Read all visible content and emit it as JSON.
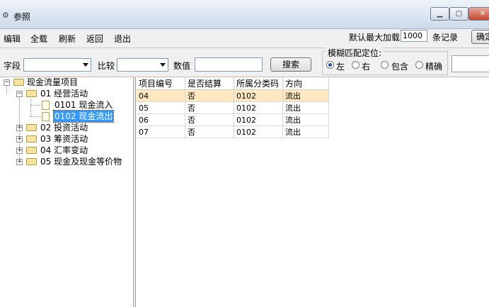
{
  "window": {
    "title": "参照",
    "icon": "app-logo-icon"
  },
  "toolbar": {
    "items": [
      "编辑",
      "全载",
      "刷新",
      "返回",
      "退出"
    ],
    "max_load_label": "默认最大加载",
    "max_load_value": "1000",
    "record_label": "条记录",
    "confirm_label": "确定"
  },
  "search": {
    "field_label": "字段",
    "compare_label": "比较",
    "value_label": "数值",
    "search_button": "搜索",
    "fuzzy_legend": "模糊匹配定位:",
    "options": [
      "左",
      "右",
      "包含",
      "精确"
    ],
    "selected_option": "左"
  },
  "tree": {
    "root": "现金流量项目",
    "nodes": [
      {
        "label": "01 经营活动",
        "children": [
          "0101 现金流入",
          "0102 现金流出"
        ]
      },
      {
        "label": "02 投资活动"
      },
      {
        "label": "03 筹资活动"
      },
      {
        "label": "04 汇率变动"
      },
      {
        "label": "05 现金及现金等价物"
      }
    ],
    "selected": "0102 现金流出"
  },
  "grid": {
    "columns": [
      "项目编号",
      "是否结算",
      "所属分类码",
      "方向"
    ],
    "rows": [
      [
        "04",
        "否",
        "0102",
        "流出"
      ],
      [
        "05",
        "否",
        "0102",
        "流出"
      ],
      [
        "06",
        "否",
        "0102",
        "流出"
      ],
      [
        "07",
        "否",
        "0102",
        "流出"
      ]
    ],
    "highlighted_row": 0
  }
}
